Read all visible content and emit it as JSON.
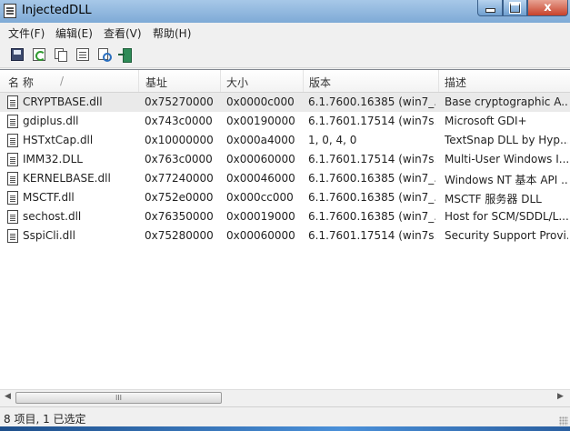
{
  "window": {
    "title": "InjectedDLL"
  },
  "titlebar_buttons": {
    "minimize": "–",
    "maximize": "□",
    "close": "x"
  },
  "menu": [
    {
      "label": "文件(F)"
    },
    {
      "label": "编辑(E)"
    },
    {
      "label": "查看(V)"
    },
    {
      "label": "帮助(H)"
    }
  ],
  "toolbar": [
    {
      "icon": "save-icon"
    },
    {
      "icon": "refresh-icon"
    },
    {
      "icon": "copy-icon"
    },
    {
      "icon": "properties-icon"
    },
    {
      "icon": "search-icon"
    },
    {
      "icon": "exit-icon"
    }
  ],
  "columns": [
    {
      "label": "名 称",
      "sort": "/"
    },
    {
      "label": "基址"
    },
    {
      "label": "大小"
    },
    {
      "label": "版本"
    },
    {
      "label": "描述"
    }
  ],
  "rows": [
    {
      "name": "CRYPTBASE.dll",
      "base": "0x75270000",
      "size": "0x0000c000",
      "version": "6.1.7600.16385 (win7_...",
      "desc": "Base cryptographic A...",
      "selected": true
    },
    {
      "name": "gdiplus.dll",
      "base": "0x743c0000",
      "size": "0x00190000",
      "version": "6.1.7601.17514 (win7s...",
      "desc": "Microsoft GDI+"
    },
    {
      "name": "HSTxtCap.dll",
      "base": "0x10000000",
      "size": "0x000a4000",
      "version": "1, 0, 4, 0",
      "desc": "TextSnap DLL by Hyp..."
    },
    {
      "name": "IMM32.DLL",
      "base": "0x763c0000",
      "size": "0x00060000",
      "version": "6.1.7601.17514 (win7s...",
      "desc": "Multi-User Windows I..."
    },
    {
      "name": "KERNELBASE.dll",
      "base": "0x77240000",
      "size": "0x00046000",
      "version": "6.1.7600.16385 (win7_...",
      "desc": "Windows NT 基本 API ..."
    },
    {
      "name": "MSCTF.dll",
      "base": "0x752e0000",
      "size": "0x000cc000",
      "version": "6.1.7600.16385 (win7_...",
      "desc": "MSCTF 服务器 DLL"
    },
    {
      "name": "sechost.dll",
      "base": "0x76350000",
      "size": "0x00019000",
      "version": "6.1.7600.16385 (win7_...",
      "desc": "Host for SCM/SDDL/L..."
    },
    {
      "name": "SspiCli.dll",
      "base": "0x75280000",
      "size": "0x00060000",
      "version": "6.1.7601.17514 (win7s...",
      "desc": "Security Support Provi..."
    }
  ],
  "scrollbar": {
    "left_arrow": "◀",
    "right_arrow": "▶",
    "grip": "III"
  },
  "status": {
    "text": "8 项目, 1 已选定"
  },
  "colors": {
    "selection": "#eaeaea",
    "titlebar": "#7eaad6",
    "close": "#c7412a"
  }
}
